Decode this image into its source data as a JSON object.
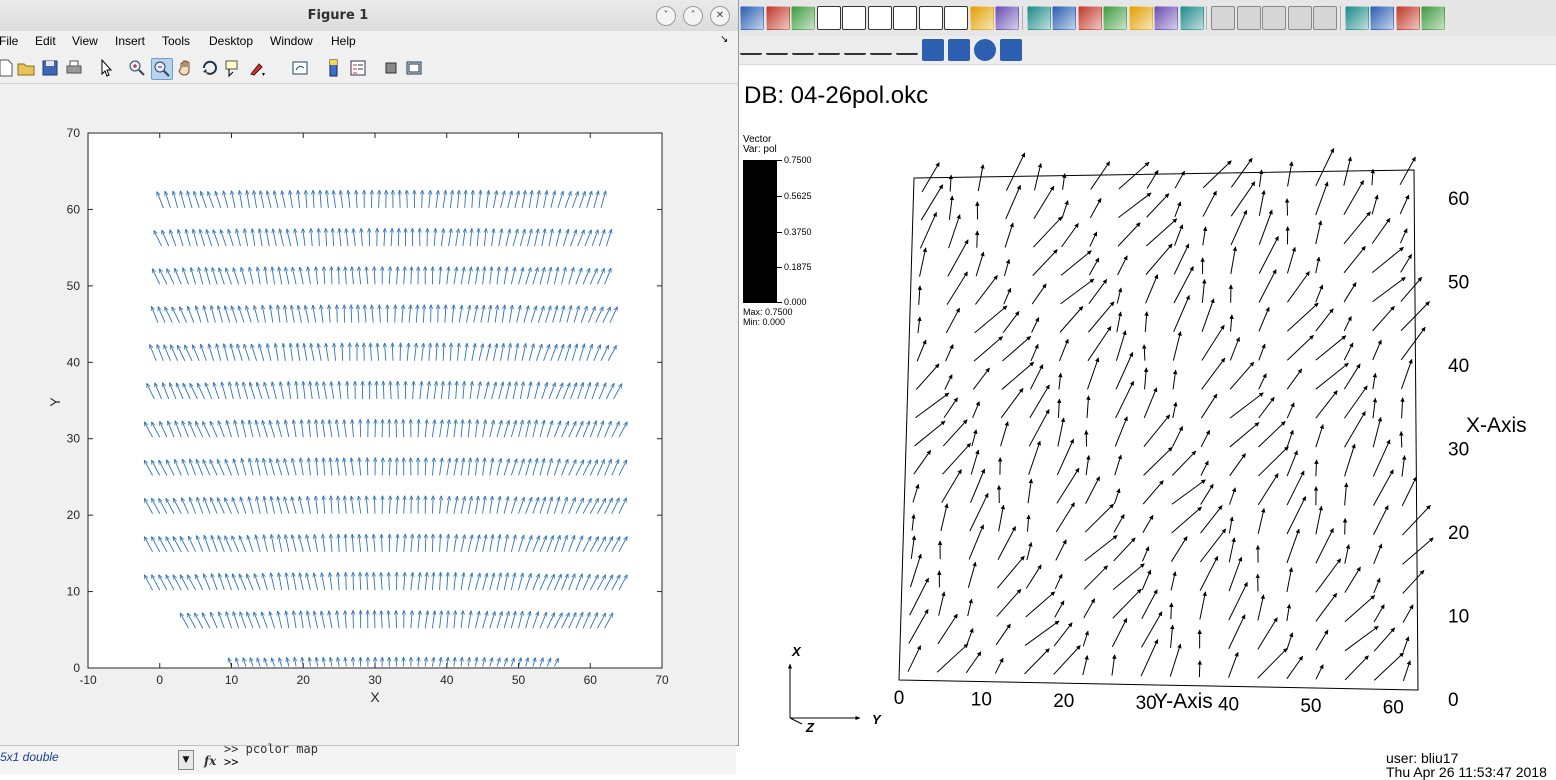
{
  "matlab": {
    "title": "Figure 1",
    "window_buttons": {
      "minimize": "˅",
      "maximize": "˄",
      "close": "✕"
    },
    "menu": [
      "File",
      "Edit",
      "View",
      "Insert",
      "Tools",
      "Desktop",
      "Window",
      "Help"
    ],
    "menu_overflow": "↘",
    "toolbar_icons": [
      "new-figure-icon",
      "open-file-icon",
      "save-icon",
      "print-icon",
      "edit-plot-arrow-icon",
      "zoom-in-icon",
      "zoom-out-icon",
      "pan-hand-icon",
      "rotate-3d-icon",
      "data-cursor-icon",
      "brush-icon",
      "link-plot-icon",
      "colorbar-icon",
      "legend-icon",
      "hide-plot-tools-icon",
      "show-plot-tools-icon"
    ],
    "plot": {
      "chart_data": {
        "type": "quiver",
        "xlabel": "X",
        "ylabel": "Y",
        "xlim": [
          -10,
          70
        ],
        "ylim": [
          0,
          70
        ],
        "xticks": [
          "-10",
          "0",
          "10",
          "20",
          "30",
          "40",
          "50",
          "60",
          "70"
        ],
        "yticks": [
          "0",
          "10",
          "20",
          "30",
          "40",
          "50",
          "60",
          "70"
        ],
        "grid": false,
        "color": "#2e72b8",
        "rows_y": [
          0,
          5,
          10,
          15,
          20,
          25,
          30,
          35,
          40,
          45,
          50,
          55,
          60
        ],
        "x_step": 1,
        "description_of_field": "arrows mostly point upward, tilted away from the center column x=32; the lowest rows are narrower"
      }
    },
    "bottom": {
      "workspace_value": "5x1 double",
      "dropdown_glyph": "▼",
      "fx": "fx",
      "previous_command": ">>  pcolor map",
      "prompt": ">>"
    }
  },
  "visit": {
    "toolbar_row1_icons": [
      "clear-window-icon",
      "copy-window-icon",
      "delete-window-icon",
      "layout-1x1-icon",
      "layout-1x2-icon",
      "layout-2x2-icon",
      "layout-2x3-icon",
      "layout-2x4-icon",
      "layout-3x3-icon",
      "lock-view-icon",
      "invert-colors-icon",
      "3d-box-icon",
      "camera-icon",
      "camera-icon",
      "camera-icon",
      "color-table-icon",
      "pick-icon",
      "globe-icon",
      "skip-back-icon",
      "step-back-icon",
      "stop-icon",
      "play-icon",
      "skip-forward-icon",
      "image-icon",
      "user-icon",
      "user-icon",
      "user-icon"
    ],
    "toolbar_row2_icons": [
      "zoom-icon",
      "line-z-icon",
      "line-n-icon",
      "line-s-icon",
      "plot-icon",
      "probe-icon",
      "line-tool-icon",
      "plane-tool-icon",
      "box-tool-icon",
      "sphere-tool-icon",
      "point-tool-icon"
    ],
    "db_title": "DB: 04-26pol.okc",
    "legend": {
      "title_line1": "Vector",
      "title_line2": "Var: pol",
      "ticks": [
        "0.7500",
        "0.5625",
        "0.3750",
        "0.1875",
        "0.000"
      ],
      "max_label": "Max:  0.7500",
      "min_label": "Min:  0.000"
    },
    "plot": {
      "chart_data": {
        "type": "quiver-3d-view",
        "x_axis_title": "X-Axis",
        "y_axis_title": "Y-Axis",
        "x_axis_ticks": [
          "0",
          "10",
          "20",
          "30",
          "40",
          "50",
          "60"
        ],
        "y_axis_ticks": [
          "0",
          "10",
          "20",
          "30",
          "40",
          "50",
          "60"
        ],
        "triad_labels": [
          "X",
          "Y",
          "Z"
        ],
        "color": "#000000"
      }
    },
    "user": "user: bliu17",
    "date": "Thu Apr 26 11:53:47 2018"
  }
}
